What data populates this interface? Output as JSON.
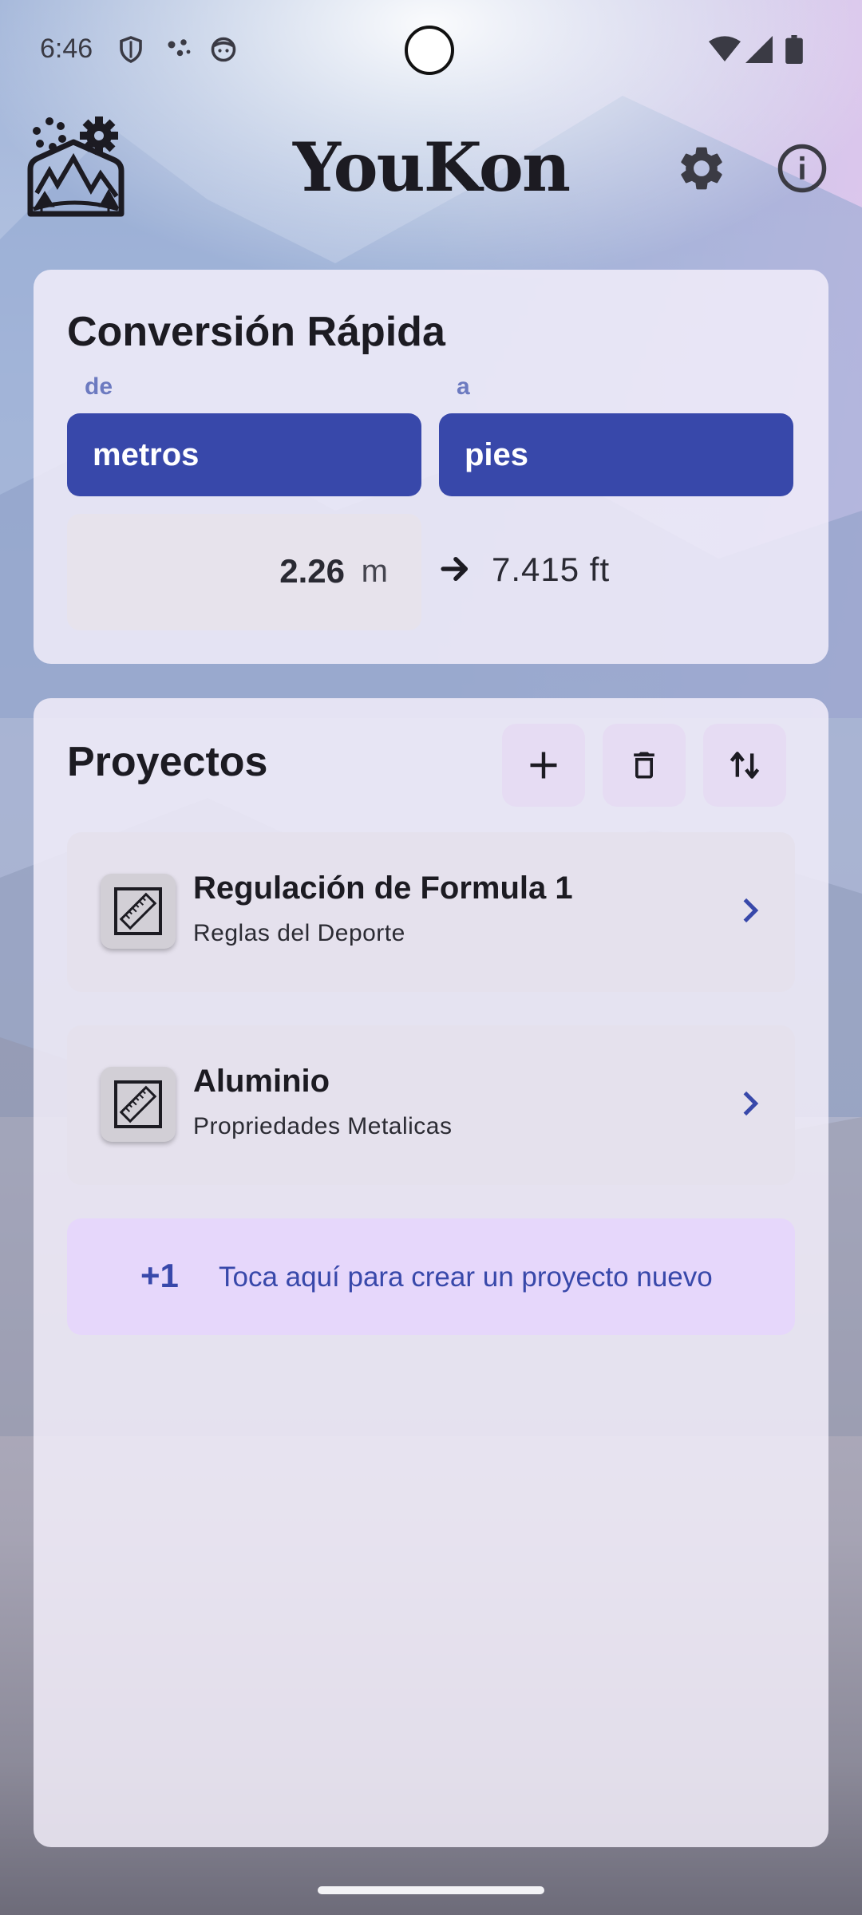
{
  "status_bar": {
    "time": "6:46"
  },
  "app": {
    "title": "YouKon"
  },
  "quick_convert": {
    "title": "Conversión Rápida",
    "from_label": "de",
    "to_label": "a",
    "from_unit": "metros",
    "to_unit": "pies",
    "input_value": "2.26",
    "input_unit": "m",
    "result": "7.415 ft"
  },
  "projects": {
    "title": "Proyectos",
    "items": [
      {
        "title": "Regulación de Formula 1",
        "subtitle": "Reglas del Deporte"
      },
      {
        "title": "Aluminio",
        "subtitle": "Propriedades Metalicas"
      }
    ],
    "create": {
      "plus": "+1",
      "label": "Toca aquí para crear un proyecto nuevo"
    }
  },
  "colors": {
    "accent": "#3848aa",
    "card": "#f3eefa",
    "create_bg": "#e6d7fb",
    "tool_btn": "#e6dcf3"
  },
  "icons": [
    "shield-icon",
    "dots-icon",
    "face-icon",
    "wifi-icon",
    "signal-icon",
    "battery-icon",
    "settings-icon",
    "info-icon",
    "plus-icon",
    "trash-icon",
    "swap-vertical-icon",
    "ruler-icon",
    "chevron-right-icon",
    "arrow-right-icon"
  ]
}
